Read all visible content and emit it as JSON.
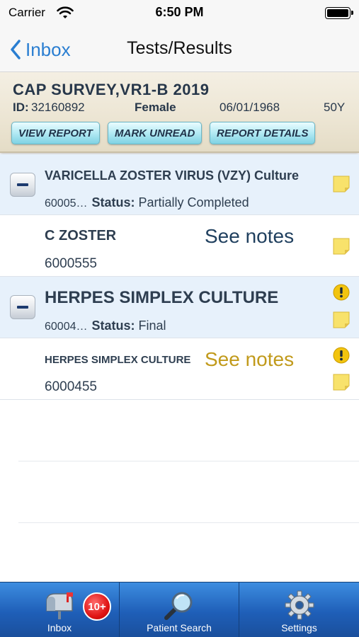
{
  "status_bar": {
    "carrier": "Carrier",
    "time": "6:50 PM"
  },
  "nav": {
    "back_label": "Inbox",
    "title": "Tests/Results"
  },
  "patient": {
    "name": "CAP SURVEY,VR1-B 2019",
    "id_label": "ID:",
    "id_value": "32160892",
    "gender": "Female",
    "dob": "06/01/1968",
    "age": "50Y",
    "buttons": {
      "view_report": "VIEW REPORT",
      "mark_unread": "MARK UNREAD",
      "report_details": "REPORT DETAILS"
    }
  },
  "results": [
    {
      "name": "VARICELLA ZOSTER VIRUS (VZY) Culture",
      "id": "60005…",
      "status_label": "Status:",
      "status": "Partially Completed",
      "children": [
        {
          "name": "C ZOSTER",
          "code": "6000555",
          "note": "See notes",
          "note_color": "#1f3f5e"
        }
      ]
    },
    {
      "name": "HERPES SIMPLEX CULTURE",
      "id": "60004…",
      "status_label": "Status:",
      "status": "Final",
      "children": [
        {
          "name": "HERPES SIMPLEX CULTURE",
          "code": "6000455",
          "note": "See notes",
          "note_color": "#c19a1b"
        }
      ]
    }
  ],
  "tabs": [
    {
      "label": "Inbox",
      "badge": "10+"
    },
    {
      "label": "Patient Search"
    },
    {
      "label": "Settings"
    }
  ],
  "colors": {
    "accent_blue": "#2a7ed1",
    "row_highlight": "#e7f1fb",
    "tab_bar": "#1f5fb8",
    "alert_yellow": "#f2c40f"
  }
}
